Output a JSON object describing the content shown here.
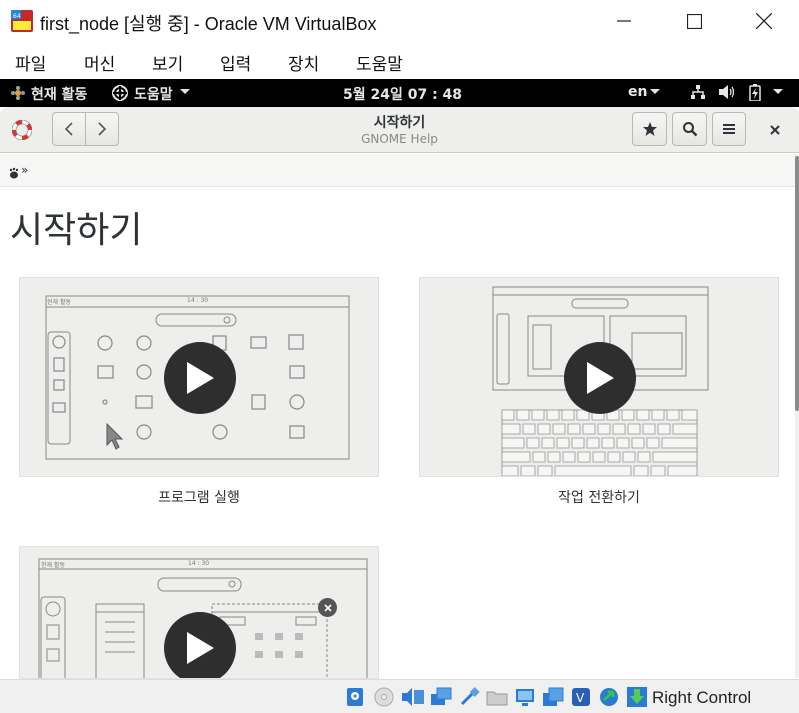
{
  "window": {
    "title": "first_node [실행 중] - Oracle VM VirtualBox",
    "controls": [
      "minimize",
      "maximize",
      "close"
    ]
  },
  "menu": {
    "file": "파일",
    "machine": "머신",
    "view": "보기",
    "input": "입력",
    "devices": "장치",
    "help": "도움말"
  },
  "gnome_bar": {
    "activities": "현재 활동",
    "app_menu": "도움말",
    "clock": "5월 24일  07 : 48",
    "lang": "en"
  },
  "help_window": {
    "title": "시작하기",
    "subtitle": "GNOME Help",
    "breadcrumb_sep": "»"
  },
  "page": {
    "heading": "시작하기",
    "videos": [
      {
        "label": "프로그램 실행",
        "thumb_time": "14 : 30",
        "thumb_activities": "현재 활동"
      },
      {
        "label": "작업 전환하기",
        "thumb_time": "",
        "thumb_activities": ""
      },
      {
        "label": "",
        "thumb_time": "14 : 30",
        "thumb_activities": "현재 활동"
      }
    ]
  },
  "status_bar": {
    "host_key": "Right Control"
  },
  "colors": {
    "gnome_bar": "#000000",
    "header_bg": "#eeeeec",
    "card_bg": "#eeeeec",
    "play_bg": "#2e2e2e"
  }
}
